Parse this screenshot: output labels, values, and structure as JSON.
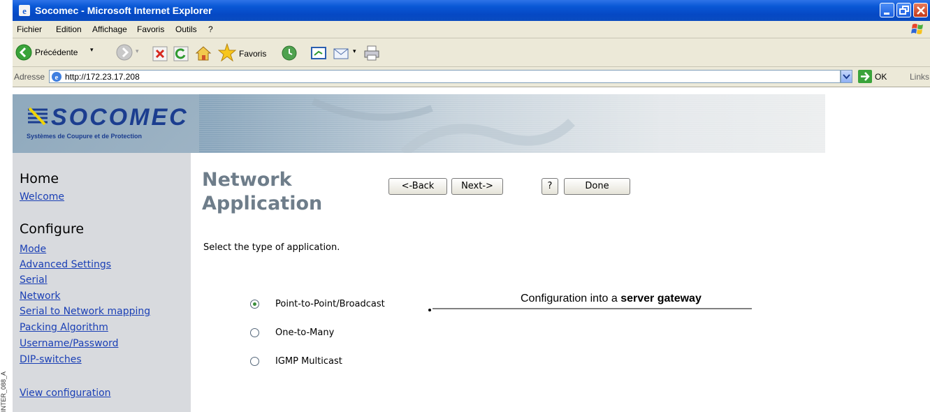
{
  "side_code": "INTER_088_A",
  "window": {
    "title": "Socomec - Microsoft Internet Explorer"
  },
  "menu": [
    "Fichier",
    "Edition",
    "Affichage",
    "Favoris",
    "Outils",
    "?"
  ],
  "toolbar": {
    "back_label": "Précédente",
    "favorites_label": "Favoris"
  },
  "address": {
    "label": "Adresse",
    "url": "http://172.23.17.208",
    "go_label": "OK",
    "links_label": "Links"
  },
  "banner": {
    "logo_text": "SOCOMEC",
    "logo_tagline": "Systèmes de Coupure et de Protection"
  },
  "sidebar": {
    "home_heading": "Home",
    "home_links": [
      "Welcome"
    ],
    "configure_heading": "Configure",
    "configure_links": [
      "Mode",
      "Advanced Settings",
      "Serial",
      "Network",
      "Serial to Network mapping",
      "Packing Algorithm",
      "Username/Password",
      "DIP-switches"
    ],
    "view_link": "View configuration"
  },
  "main": {
    "title": "Network Application",
    "buttons": {
      "back": "<-Back",
      "next": "Next->",
      "help": "?",
      "done": "Done"
    },
    "instruction": "Select the type of application.",
    "options": [
      {
        "label": "Point-to-Point/Broadcast",
        "checked": true
      },
      {
        "label": "One-to-Many",
        "checked": false
      },
      {
        "label": "IGMP Multicast",
        "checked": false
      }
    ]
  },
  "annotation": {
    "prefix": "Configuration into a ",
    "bold": "server gateway"
  },
  "colors": {
    "titlebar": "#0a58d6",
    "link": "#1a3fb5",
    "title_text": "#6e7d8a",
    "sidebar_bg": "#d8dade"
  }
}
